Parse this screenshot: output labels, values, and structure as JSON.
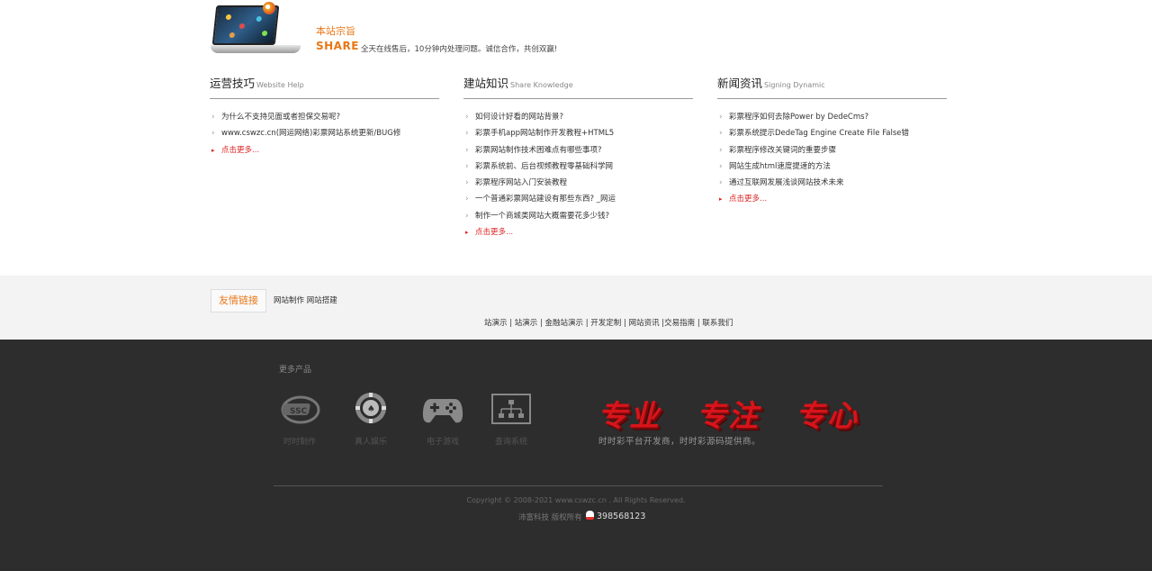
{
  "banner": {
    "title": "本站宗旨",
    "share": "SHARE",
    "slogan": "全天在线售后，10分钟内处理问题。诚信合作，共创双赢!"
  },
  "columns": [
    {
      "title": "运营技巧",
      "subtitle": "Website Help",
      "items": [
        "为什么不支持见面或者担保交易呢?",
        "www.cswzc.cn(网运网络)彩票网站系统更新/BUG修"
      ],
      "more": "点击更多..."
    },
    {
      "title": "建站知识",
      "subtitle": "Share Knowledge",
      "items": [
        "如何设计好看的网站背景?",
        "彩票手机app网站制作开发教程+HTML5",
        "彩票网站制作技术困难点有哪些事项?",
        "彩票系统前、后台视频教程零基础科学网",
        "彩票程序网站入门安装教程",
        "一个普通彩票网站建设有那些东西? _网运",
        "制作一个商城类网站大概需要花多少钱?"
      ],
      "more": "点击更多..."
    },
    {
      "title": "新闻资讯",
      "subtitle": "Signing Dynamic",
      "items": [
        "彩票程序如何去除Power by DedeCms?",
        "彩票系统提示DedeTag Engine Create File False错",
        "彩票程序修改关键词的重要步骤",
        "网站生成html速度提速的方法",
        "通过互联网发展浅谈网站技术未来"
      ],
      "more": "点击更多..."
    }
  ],
  "friend_links": {
    "label": "友情链接",
    "items": "网站制作 网站搭建"
  },
  "nav_line": "站演示 | 站演示 | 金融站演示 | 开发定制 | 网站资讯 |交易指南 | 联系我们",
  "footer": {
    "more_title": "更多产品",
    "products": [
      {
        "label": "时时制作",
        "icon": "lottery-logo-icon"
      },
      {
        "label": "真人娱乐",
        "icon": "casino-chip-icon"
      },
      {
        "label": "电子游戏",
        "icon": "gamepad-icon"
      },
      {
        "label": "查询系统",
        "icon": "sitemap-icon"
      }
    ],
    "slogan_words": [
      "专业",
      "专注",
      "专心"
    ],
    "sub_slogan": "时时彩平台开发商，时时彩源码提供商。",
    "copyright": "Copyright © 2008-2021 www.cswzc.cn . All Rights Reserved.",
    "owner": "沛富科技 版权所有",
    "qq": "398568123",
    "colors": {
      "accent": "#e87716",
      "slogan_red": "#d8141a",
      "footer_bg": "#2d2d2d"
    }
  }
}
